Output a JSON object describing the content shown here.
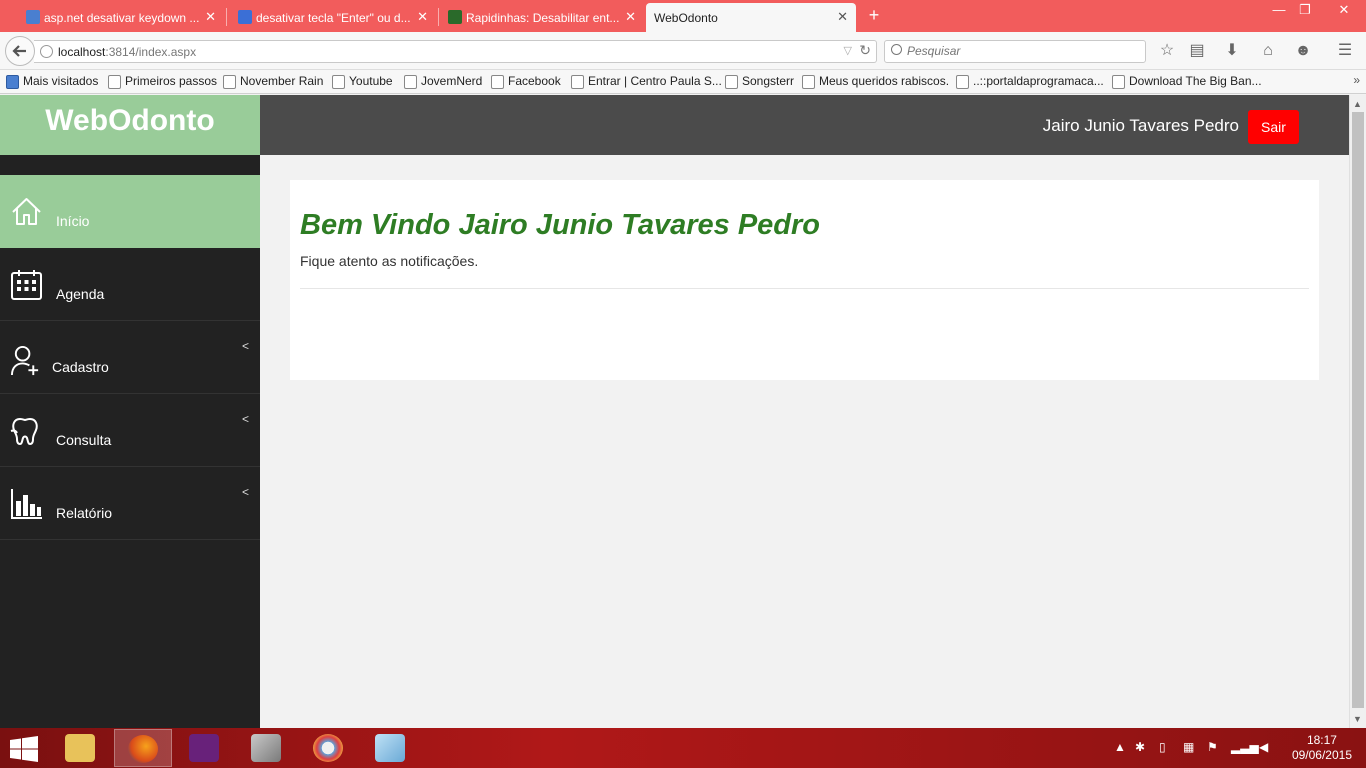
{
  "browser": {
    "tabs": [
      {
        "title": "asp.net desativar keydown ...",
        "favicon": "google-icon"
      },
      {
        "title": "desativar tecla \"Enter\" ou d...",
        "favicon": "devmedia-icon"
      },
      {
        "title": "Rapidinhas: Desabilitar ent...",
        "favicon": "site-icon"
      },
      {
        "title": "WebOdonto",
        "favicon": ""
      }
    ],
    "url_host": "localhost",
    "url_rest": ":3814/index.aspx",
    "search_placeholder": "Pesquisar",
    "bookmarks": [
      "Mais visitados",
      "Primeiros passos",
      "November Rain",
      "Youtube",
      "JovemNerd",
      "Facebook",
      "Entrar | Centro Paula S...",
      "Songsterr",
      "Meus queridos rabiscos.",
      "..::portaldaprogramaca...",
      "Download The Big Ban..."
    ]
  },
  "app": {
    "brand": "WebOdonto",
    "user_name": "Jairo Junio Tavares Pedro",
    "logout_label": "Sair",
    "menu": [
      {
        "label": "Início",
        "icon": "home-icon",
        "active": true
      },
      {
        "label": "Agenda",
        "icon": "calendar-icon"
      },
      {
        "label": "Cadastro",
        "icon": "user-add-icon",
        "expandable": true
      },
      {
        "label": "Consulta",
        "icon": "tooth-icon",
        "expandable": true
      },
      {
        "label": "Relatório",
        "icon": "bar-chart-icon",
        "expandable": true
      }
    ],
    "welcome": "Bem Vindo Jairo Junio Tavares Pedro",
    "subtext": "Fique atento as notificações."
  },
  "taskbar": {
    "time": "18:17",
    "date": "09/06/2015"
  },
  "colors": {
    "brand_green": "#99cc99",
    "welcome_green": "#2e7d24",
    "logout_red": "#ff0000",
    "sidebar_dark": "#222222",
    "topbar_gray": "#4b4b4b",
    "tabstrip_red": "#f25c5c"
  }
}
